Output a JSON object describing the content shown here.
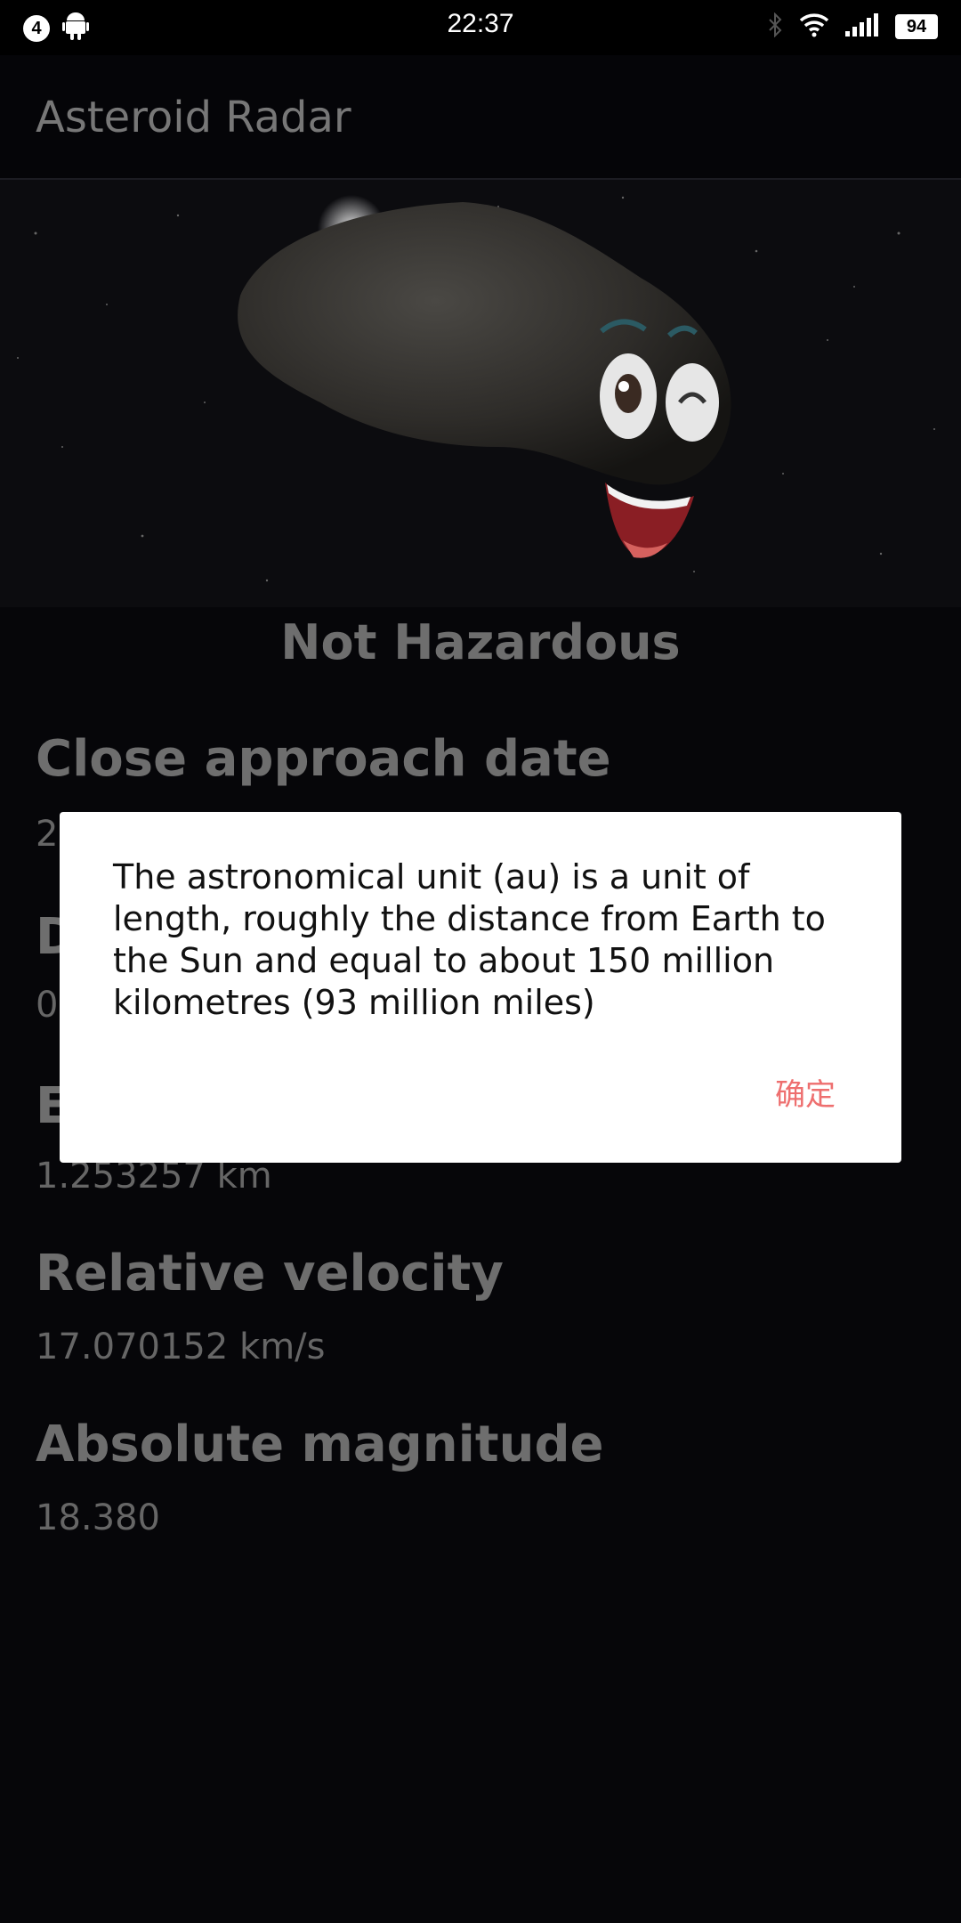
{
  "status_bar": {
    "notification_count": "4",
    "time": "22:37",
    "battery": "94",
    "icons": [
      "android-icon",
      "bluetooth-icon",
      "wifi-icon",
      "signal-icon",
      "battery-icon"
    ]
  },
  "app": {
    "title": "Asteroid Radar"
  },
  "asteroid": {
    "hazard_status": "Not Hazardous",
    "fields": [
      {
        "label": "Close approach date",
        "value": "2"
      },
      {
        "label": "D",
        "value": "0"
      },
      {
        "label": "E",
        "value": "1.253257 km"
      },
      {
        "label": "Relative velocity",
        "value": "17.070152 km/s"
      },
      {
        "label": "Absolute magnitude",
        "value": "18.380"
      }
    ]
  },
  "dialog": {
    "message": "The astronomical unit (au) is a unit of length, roughly the distance from Earth to the Sun and equal to about 150 million kilometres (93 million miles)",
    "confirm_label": "确定"
  },
  "colors": {
    "background": "#060609",
    "dialog_button": "#ee6f6f",
    "dimmed_text": "#6e6e6e"
  }
}
